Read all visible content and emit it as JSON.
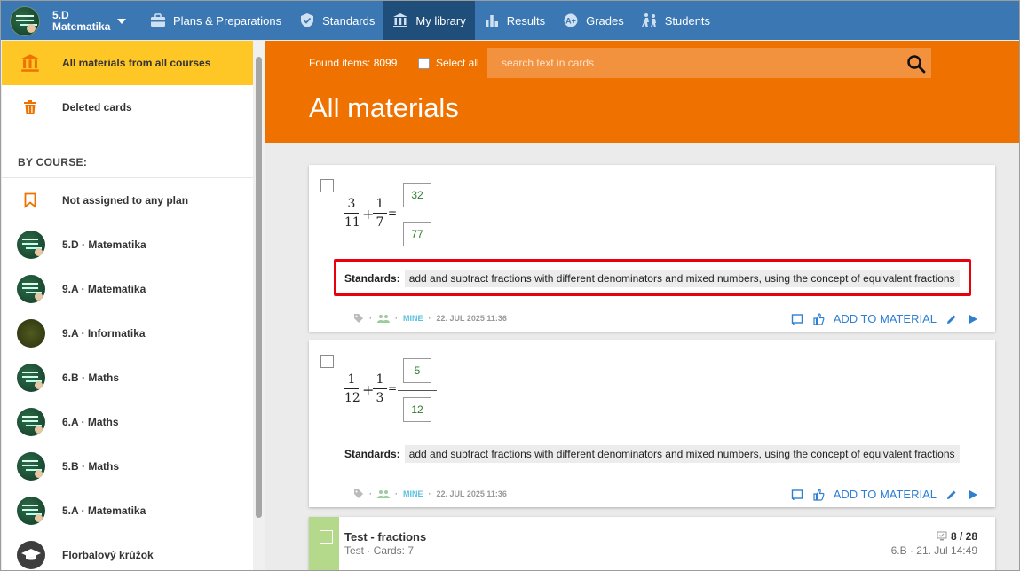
{
  "header": {
    "course_line1": "5.D",
    "course_line2": "Matematika",
    "nav": [
      {
        "label": "Plans & Preparations",
        "icon": "briefcase-icon"
      },
      {
        "label": "Standards",
        "icon": "shield-check-icon"
      },
      {
        "label": "My library",
        "icon": "library-icon",
        "active": true
      },
      {
        "label": "Results",
        "icon": "bar-chart-icon"
      },
      {
        "label": "Grades",
        "icon": "grades-icon"
      },
      {
        "label": "Students",
        "icon": "students-icon"
      }
    ]
  },
  "sidebar": {
    "all_materials": "All materials from all courses",
    "deleted": "Deleted cards",
    "by_course_heading": "BY COURSE:",
    "not_assigned": "Not assigned to any plan",
    "courses": [
      "5.D · Matematika",
      "9.A · Matematika",
      "9.A · Informatika",
      "6.B · Maths",
      "6.A · Maths",
      "5.B · Maths",
      "5.A · Matematika",
      "Florbalový krúžok"
    ]
  },
  "main": {
    "found_label": "Found items: 8099",
    "select_all": "Select all",
    "search_placeholder": "search text in cards",
    "title": "All materials"
  },
  "cards": [
    {
      "frac1_num": "3",
      "frac1_den": "11",
      "frac2_num": "1",
      "frac2_den": "7",
      "ans_num": "32",
      "ans_den": "77",
      "standards_label": "Standards:",
      "standards_value": "add and subtract fractions with different denominators and mixed numbers, using the concept of equivalent fractions",
      "mine": "MINE",
      "date": "22. JUL 2025 11:36",
      "add_label": "ADD TO MATERIAL"
    },
    {
      "frac1_num": "1",
      "frac1_den": "12",
      "frac2_num": "1",
      "frac2_den": "3",
      "ans_num": "5",
      "ans_den": "12",
      "standards_label": "Standards:",
      "standards_value": "add and subtract fractions with different denominators and mixed numbers, using the concept of equivalent fractions",
      "mine": "MINE",
      "date": "22. JUL 2025 11:36",
      "add_label": "ADD TO MATERIAL"
    }
  ],
  "test_card": {
    "title": "Test - fractions",
    "subtitle": "Test · Cards: 7",
    "score": "8 / 28",
    "class_date": "6.B · 21. Jul 14:49"
  },
  "colors": {
    "topbar": "#3a77b3",
    "nav_active": "#1f4e7a",
    "hero": "#ef7200",
    "sidebar_active": "#ffc726",
    "highlight": "#e8000b",
    "link": "#2f7fd1"
  }
}
